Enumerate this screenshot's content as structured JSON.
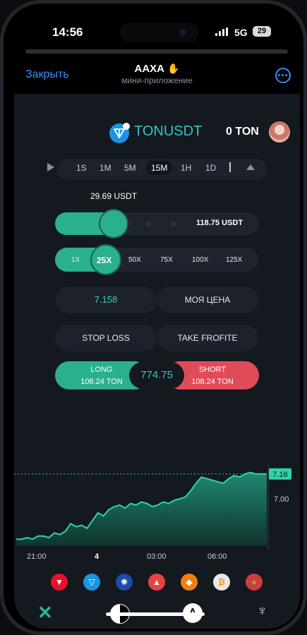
{
  "status": {
    "time": "14:56",
    "network": "5G",
    "battery": "29"
  },
  "header": {
    "close_label": "Закрыть",
    "title": "AAXA",
    "subtitle": "мини-приложение"
  },
  "pair": {
    "symbol": "TONUSDT",
    "balance": "0 TON"
  },
  "timeframes": {
    "options": [
      "1S",
      "1M",
      "5M",
      "15M",
      "1H",
      "1D"
    ],
    "selected": "15M"
  },
  "amount": {
    "current": "29.69 USDT",
    "max": "118.75 USDT",
    "fill_fraction": 0.25
  },
  "leverage": {
    "options": [
      "1X",
      "25X",
      "50X",
      "75X",
      "100X",
      "125X"
    ],
    "selected": "25X"
  },
  "inputs": {
    "price_value": "7.158",
    "my_price_label": "МОЯ ЦЕНА",
    "stop_loss_label": "STOP LOSS",
    "take_profit_label": "TAKE FROFITE"
  },
  "trade": {
    "long_label": "LONG",
    "long_amount": "108.24 TON",
    "short_label": "SHORT",
    "short_amount": "108.24 TON",
    "price": "774.75"
  },
  "chart_data": {
    "type": "area",
    "x": [
      0,
      1,
      2,
      3,
      4,
      5,
      6,
      7,
      8,
      9,
      10,
      11,
      12,
      13,
      14,
      15,
      16,
      17,
      18,
      19,
      20,
      21,
      22,
      23,
      24,
      25,
      26,
      27,
      28,
      29,
      30,
      31,
      32,
      33,
      34,
      35,
      36,
      37,
      38,
      39,
      40,
      41,
      42,
      43,
      44,
      45,
      46
    ],
    "values": [
      6.74,
      6.74,
      6.75,
      6.74,
      6.76,
      6.76,
      6.75,
      6.78,
      6.77,
      6.79,
      6.84,
      6.82,
      6.83,
      6.81,
      6.86,
      6.91,
      6.89,
      6.93,
      6.95,
      6.96,
      6.94,
      6.97,
      6.96,
      6.98,
      6.97,
      6.95,
      6.96,
      6.98,
      6.97,
      6.99,
      7.0,
      7.01,
      7.05,
      7.1,
      7.14,
      7.13,
      7.12,
      7.11,
      7.1,
      7.13,
      7.15,
      7.14,
      7.16,
      7.17,
      7.16,
      7.16,
      7.16
    ],
    "tick_labels": [
      "21:00",
      "4",
      "03:00",
      "06:00"
    ],
    "y_ticks": [
      "7.16",
      "7.00"
    ],
    "current_price": "7.16",
    "ylim": [
      6.7,
      7.2
    ],
    "line_color": "#2fd5a8"
  },
  "coins": [
    {
      "name": "tron",
      "color": "#e8102a"
    },
    {
      "name": "ton",
      "color": "#1b95e0"
    },
    {
      "name": "cardano",
      "color": "#1a4ca8"
    },
    {
      "name": "avalanche",
      "color": "#e84142"
    },
    {
      "name": "shiba",
      "color": "#f0800c"
    },
    {
      "name": "bitcoin",
      "color": "#e8e8e8"
    },
    {
      "name": "pepe",
      "color": "#d23c3c"
    }
  ],
  "colors": {
    "accent": "#2ab08c",
    "short": "#e04b5a",
    "link": "#3a8ef5"
  }
}
